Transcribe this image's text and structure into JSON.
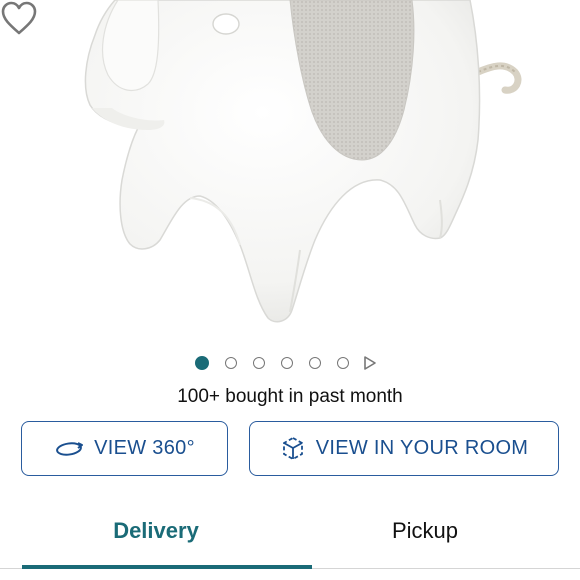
{
  "product": {
    "image_icon": "elephant-sound-machine-image",
    "favorite_icon": "heart-outline-icon"
  },
  "carousel": {
    "dot_count": 6,
    "active_index": 0,
    "play_icon": "play-triangle-icon"
  },
  "social_proof": {
    "text": "100+ bought in past month"
  },
  "actions": {
    "view360": {
      "label": "VIEW 360°",
      "icon": "rotate-360-icon"
    },
    "view_room": {
      "label": "VIEW IN YOUR ROOM",
      "icon": "ar-cube-icon"
    }
  },
  "tabs": [
    {
      "label": "Delivery",
      "selected": true
    },
    {
      "label": "Pickup",
      "selected": false
    }
  ],
  "colors": {
    "accent": "#1a6b77",
    "button_text": "#1a4f8f",
    "button_border": "#2a5c9e"
  }
}
